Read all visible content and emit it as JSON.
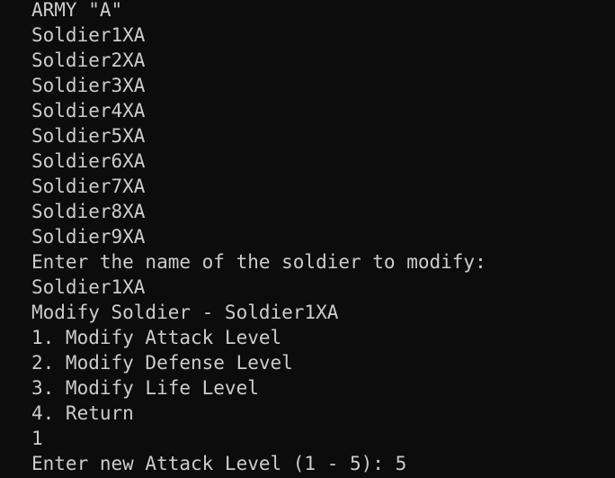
{
  "terminal": {
    "text_color": "#cccccc",
    "background_color": "#0c0c0c",
    "lines": [
      "ARMY \"A\"",
      "Soldier1XA",
      "Soldier2XA",
      "Soldier3XA",
      "Soldier4XA",
      "Soldier5XA",
      "Soldier6XA",
      "Soldier7XA",
      "Soldier8XA",
      "Soldier9XA",
      "Enter the name of the soldier to modify:",
      "Soldier1XA",
      "Modify Soldier - Soldier1XA",
      "1. Modify Attack Level",
      "2. Modify Defense Level",
      "3. Modify Life Level",
      "4. Return",
      "1",
      "Enter new Attack Level (1 - 5): 5"
    ]
  }
}
